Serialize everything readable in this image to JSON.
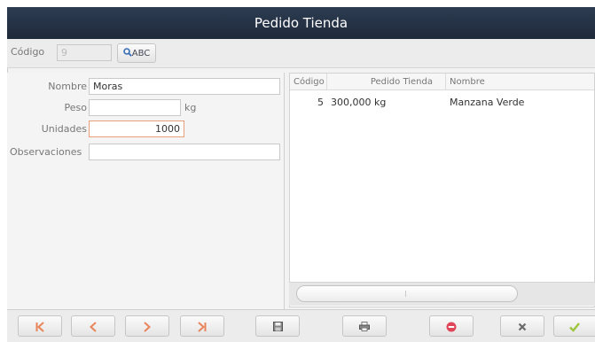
{
  "window": {
    "title": "Pedido Tienda"
  },
  "header": {
    "codigo_label": "Código",
    "codigo_value": "9",
    "search_button_label": "ABC"
  },
  "form": {
    "nombre_label": "Nombre",
    "nombre_value": "Moras",
    "peso_label": "Peso",
    "peso_value": "",
    "peso_unit": "kg",
    "unidades_label": "Unidades",
    "unidades_value": "1000",
    "observaciones_label": "Observaciones",
    "observaciones_value": ""
  },
  "table": {
    "columns": [
      "Código",
      "Pedido Tienda",
      "Nombre"
    ],
    "rows": [
      {
        "codigo": "5",
        "pedido": "300,000 kg",
        "nombre": "Manzana Verde"
      }
    ]
  },
  "toolbar": {
    "first_icon": "first-record-icon",
    "prev_icon": "previous-record-icon",
    "next_icon": "next-record-icon",
    "last_icon": "last-record-icon",
    "save_icon": "save-icon",
    "print_icon": "print-icon",
    "delete_icon": "delete-icon",
    "cancel_icon": "cancel-icon",
    "accept_icon": "accept-icon"
  },
  "colors": {
    "titlebar": "#1f2a3b",
    "nav_arrows": "#e8845a",
    "delete": "#e0455a",
    "accept": "#9cc43c"
  }
}
